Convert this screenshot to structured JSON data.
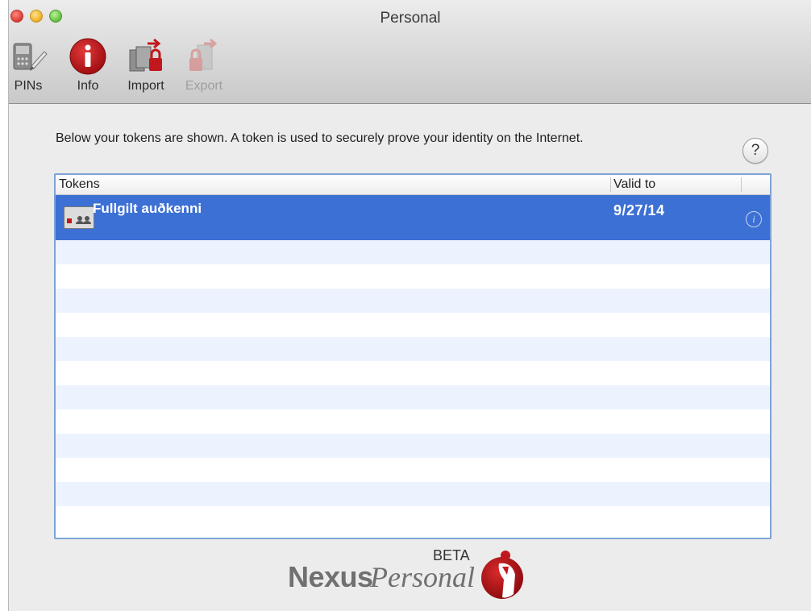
{
  "window": {
    "title": "Personal"
  },
  "toolbar": {
    "items": [
      {
        "label": "PINs",
        "icon": "pins-icon",
        "enabled": true
      },
      {
        "label": "Info",
        "icon": "info-icon",
        "enabled": true
      },
      {
        "label": "Import",
        "icon": "import-icon",
        "enabled": true
      },
      {
        "label": "Export",
        "icon": "export-icon",
        "enabled": false
      }
    ]
  },
  "main": {
    "intro": "Below your tokens are shown. A token is used to securely prove your identity on the Internet.",
    "help_label": "?"
  },
  "table": {
    "columns": [
      "Tokens",
      "Valid to"
    ],
    "rows": [
      {
        "name": "Fullgilt auðkenni",
        "valid_to": "9/27/14",
        "selected": true,
        "info_glyph": "i"
      }
    ]
  },
  "branding": {
    "name": "Nexus",
    "product": "Personal",
    "badge": "BETA"
  },
  "colors": {
    "selection": "#3d70d4",
    "accent_red": "#c0181c",
    "stripe": "#edf3fe",
    "table_border": "#7fa3d6"
  }
}
